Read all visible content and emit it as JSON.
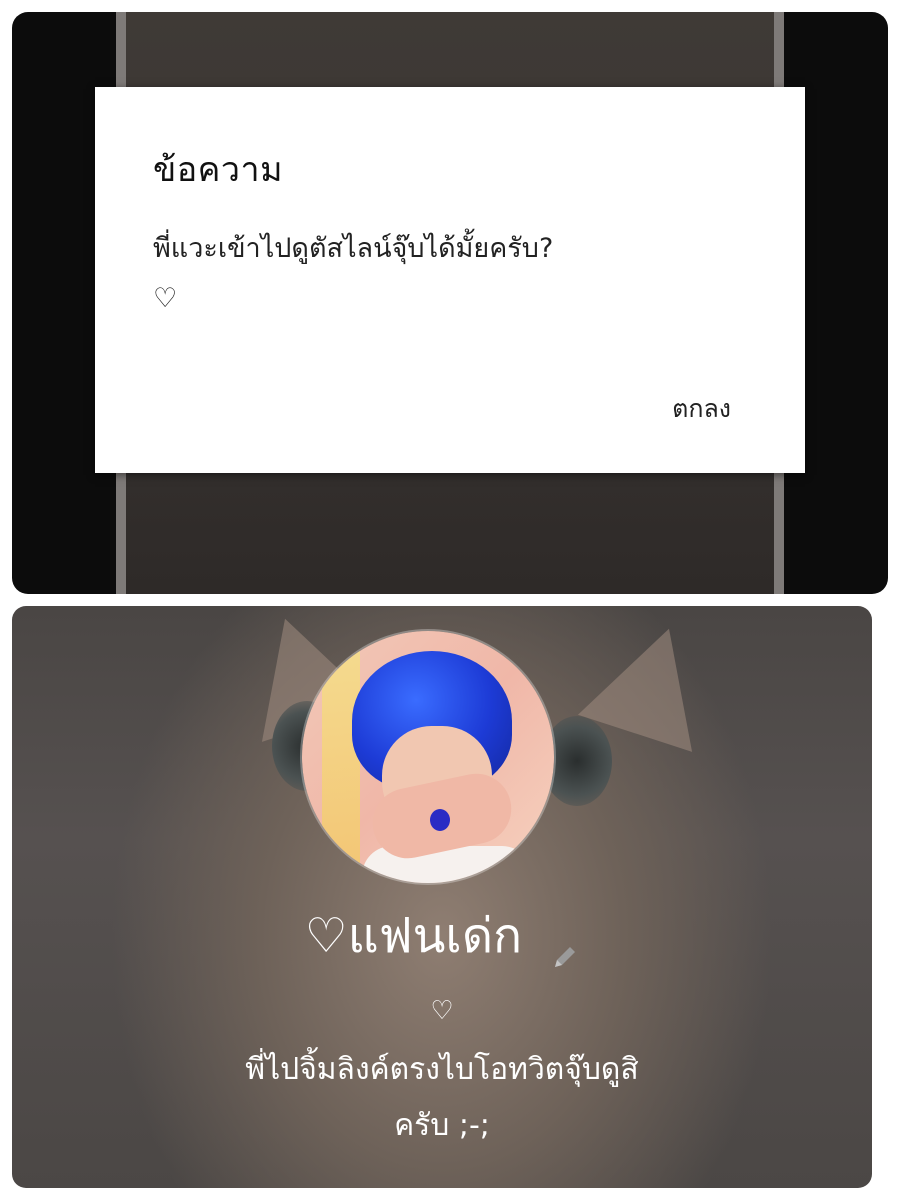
{
  "dialog": {
    "title": "ข้อความ",
    "message": "พี่แวะเข้าไปดูตัสไลน์จุ๊บได้มั้ยครับ?\n♡",
    "ok_label": "ตกลง"
  },
  "profile": {
    "name": "♡แฟนเด่ก",
    "heart": "♡",
    "status_message": "พี่ไปจิ้มลิงค์ตรงไบโอทวิตจุ๊บดูสิ\nครับ ;-;"
  },
  "colors": {
    "dialog_background": "#ffffff",
    "top_panel_background": "#0c0c0c",
    "profile_text": "#ffffff",
    "avatar_hair": "#1d3bd6"
  },
  "icons": {
    "edit": "pencil-icon"
  }
}
